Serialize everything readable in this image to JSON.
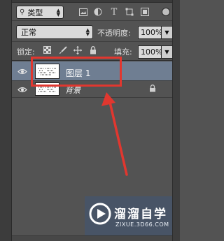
{
  "filter": {
    "kind_label": "类型",
    "icons": [
      "image-filter-icon",
      "adjustment-filter-icon",
      "text-filter-icon",
      "shape-filter-icon",
      "smart-object-filter-icon"
    ]
  },
  "blend": {
    "mode": "正常",
    "opacity_label": "不透明度:",
    "opacity_value": "100%"
  },
  "lock": {
    "label": "锁定:",
    "fill_label": "填充:",
    "fill_value": "100%"
  },
  "layers": [
    {
      "name": "图层 1",
      "selected": true
    },
    {
      "name": "背景",
      "selected": false,
      "locked": true
    }
  ],
  "watermark": {
    "name": "溜溜自学",
    "url": "ZIXUE.3D66.COM"
  },
  "colors": {
    "panel_bg": "#535353",
    "selected_row": "#6f7e92",
    "annotation_red": "#e1372f"
  }
}
